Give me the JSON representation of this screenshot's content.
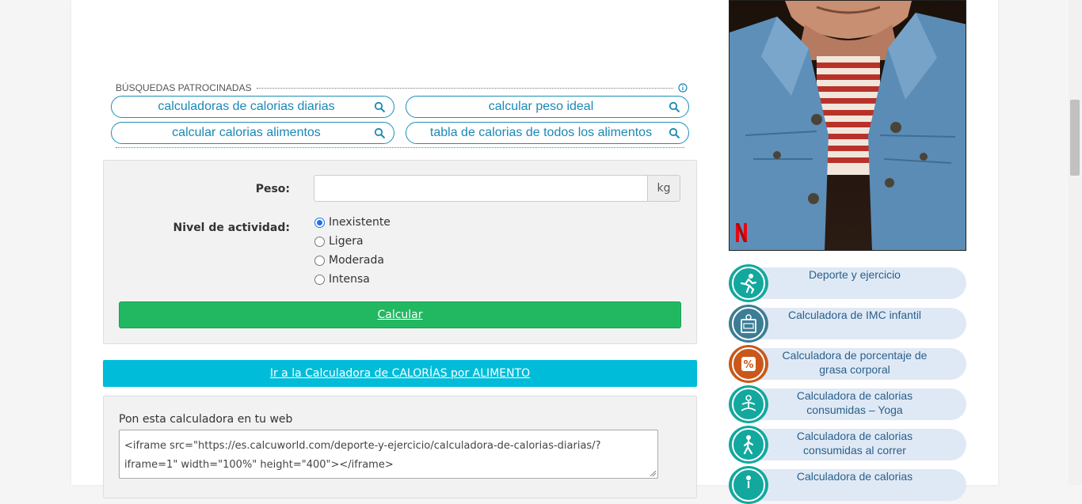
{
  "sponsored": {
    "header": "BÚSQUEDAS PATROCINADAS",
    "chips": [
      "calculadoras de calorias diarias",
      "calcular peso ideal",
      "calcular calorias alimentos",
      "tabla de calorias de todos los alimentos"
    ]
  },
  "calculator": {
    "weight_label": "Peso:",
    "weight_value": "",
    "weight_unit": "kg",
    "activity_label": "Nivel de actividad:",
    "activity_options": [
      "Inexistente",
      "Ligera",
      "Moderada",
      "Intensa"
    ],
    "activity_selected": "Inexistente",
    "submit_label": "Calcular"
  },
  "food_link": "Ir a la Calculadora de CALORÍAS por ALIMENTO",
  "embed": {
    "label": "Pon esta calculadora en tu web",
    "code": "<iframe src=\"https://es.calcuworld.com/deporte-y-ejercicio/calculadora-de-calorias-diarias/?iframe=1\" width=\"100%\" height=\"400\"></iframe>"
  },
  "ad": {
    "brand_mark": "N"
  },
  "sidebar": {
    "items": [
      {
        "label": "Deporte y ejercicio",
        "icon": "running-icon",
        "color": "#12a89e"
      },
      {
        "label": "Calculadora de IMC infantil",
        "icon": "scale-imc-icon",
        "color": "#3b7d95"
      },
      {
        "label": "Calculadora de porcentaje de grasa corporal",
        "icon": "percent-icon",
        "color": "#c9581a"
      },
      {
        "label": "Calculadora de calorias consumidas – Yoga",
        "icon": "yoga-icon",
        "color": "#12a89e"
      },
      {
        "label": "Calculadora de calorias consumidas al correr",
        "icon": "running-icon",
        "color": "#12a89e"
      },
      {
        "label": "Calculadora de calorias",
        "icon": "walking-icon",
        "color": "#12a89e"
      }
    ]
  },
  "colors": {
    "calc_button": "#22b862",
    "food_button": "#00bcd9",
    "chip_accent": "#1a88b6",
    "sidebar_pill": "#dfe9f5"
  }
}
